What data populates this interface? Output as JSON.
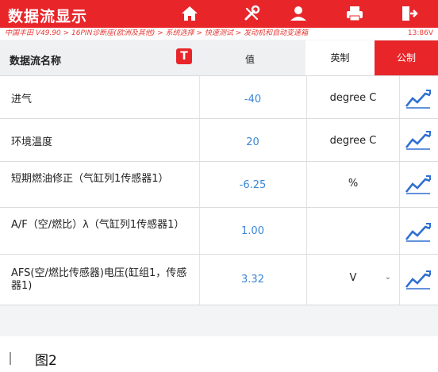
{
  "title": "数据流显示",
  "toolbar": {
    "icons": [
      "home-icon",
      "settings-tool-icon",
      "user-icon",
      "print-icon",
      "exit-icon"
    ]
  },
  "breadcrumb": {
    "path": "中国丰田 V49.90 > 16PIN诊断座(欧洲及其他) > 系统选择 > 快速测试 > 发动机和自动变速箱",
    "time": "13:86V"
  },
  "header": {
    "name_label": "数据流名称",
    "t_icon": "T",
    "value_label": "值",
    "imperial_label": "英制",
    "metric_label": "公制"
  },
  "rows": [
    {
      "name": "进气",
      "value": "-40",
      "unit": "degree C"
    },
    {
      "name": "环境温度",
      "value": "20",
      "unit": "degree C"
    },
    {
      "name": "短期燃油修正（气缸列1传感器1）",
      "value": "-6.25",
      "unit": "%"
    },
    {
      "name": "A/F（空/燃比）λ（气缸列1传感器1）",
      "value": "1.00",
      "unit": ""
    },
    {
      "name": "AFS(空/燃比传感器)电压(缸组1，传感器1)",
      "value": "3.32",
      "unit": "V"
    }
  ],
  "caption": "图2",
  "colors": {
    "brand_red": "#e8262a",
    "value_blue": "#3a86d6",
    "graph_blue": "#2f6fd1"
  }
}
